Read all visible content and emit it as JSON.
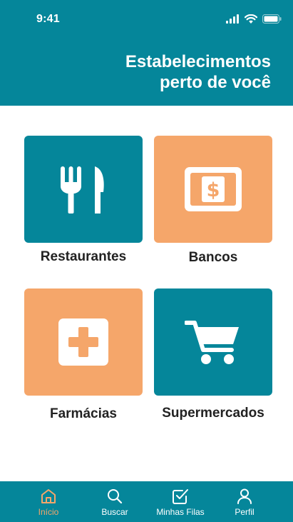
{
  "status_bar": {
    "time": "9:41"
  },
  "header": {
    "title_line1": "Estabelecimentos",
    "title_line2": "perto de você"
  },
  "categories": [
    {
      "label": "Restaurantes",
      "icon": "utensils-icon",
      "color": "#05869a"
    },
    {
      "label": "Bancos",
      "icon": "money-bill-icon",
      "color": "#f5a66a"
    },
    {
      "label": "Farmácias",
      "icon": "medical-cross-icon",
      "color": "#f5a66a"
    },
    {
      "label": "Supermercados",
      "icon": "shopping-cart-icon",
      "color": "#05869a"
    }
  ],
  "tabbar": {
    "items": [
      {
        "label": "Início",
        "icon": "home-icon",
        "active": true
      },
      {
        "label": "Buscar",
        "icon": "search-icon",
        "active": false
      },
      {
        "label": "Minhas Filas",
        "icon": "checkbox-icon",
        "active": false
      },
      {
        "label": "Perfil",
        "icon": "user-icon",
        "active": false
      }
    ]
  },
  "colors": {
    "primary": "#05869a",
    "accent": "#f5a66a",
    "background": "#ffffff",
    "text": "#222222"
  }
}
